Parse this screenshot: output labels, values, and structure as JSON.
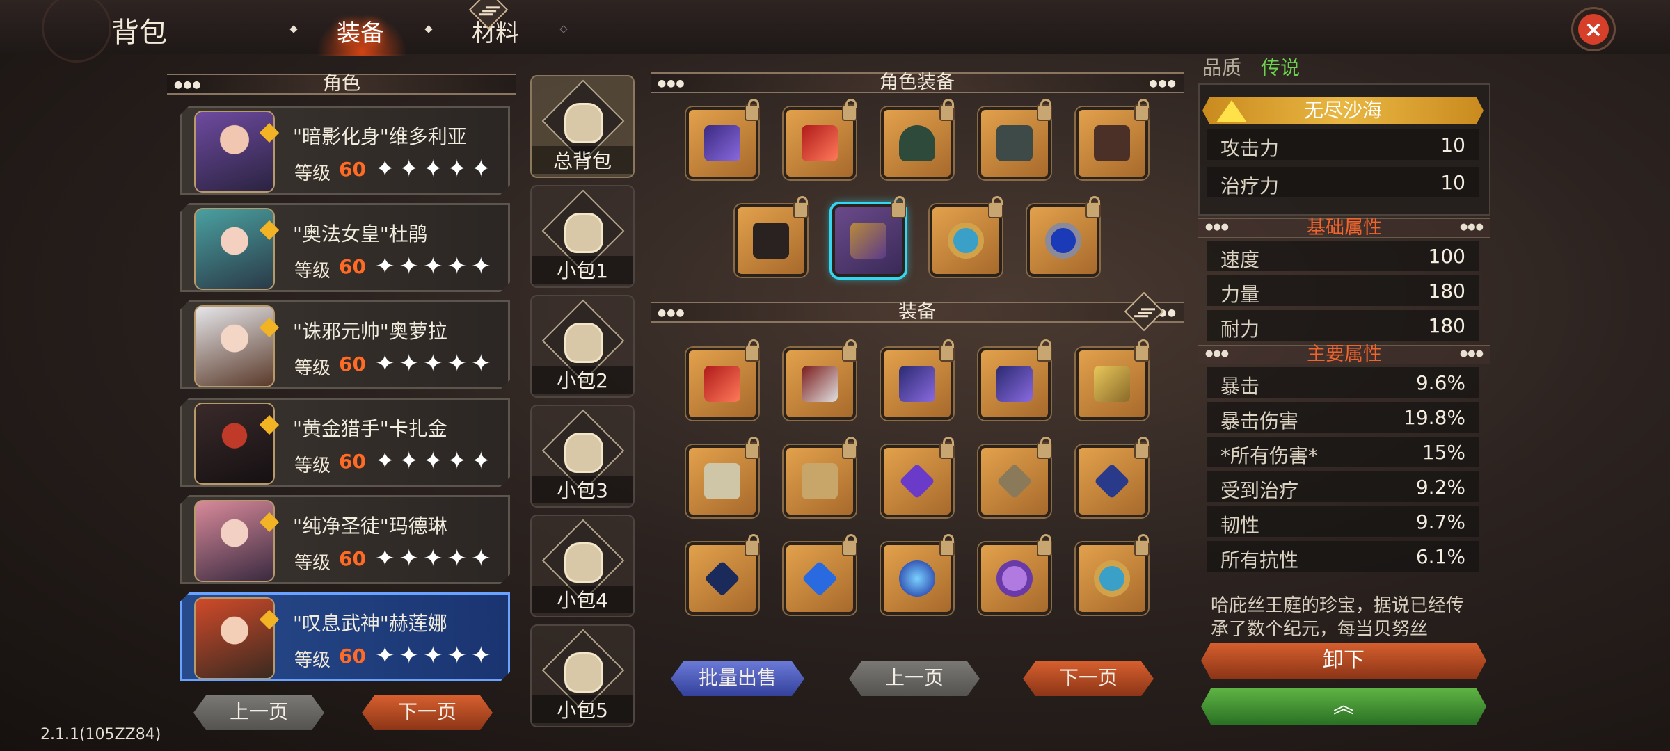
{
  "header": {
    "title": "背包",
    "tabs": [
      {
        "label": "装备",
        "active": true
      },
      {
        "label": "材料",
        "active": false
      }
    ]
  },
  "roles": {
    "heading": "角色",
    "items": [
      {
        "name": "\"暗影化身\"维多利亚",
        "level_label": "等级",
        "level": "60",
        "stars": "✦✦✦✦✦",
        "active": false
      },
      {
        "name": "\"奥法女皇\"杜鹃",
        "level_label": "等级",
        "level": "60",
        "stars": "✦✦✦✦✦",
        "active": false
      },
      {
        "name": "\"诛邪元帅\"奥萝拉",
        "level_label": "等级",
        "level": "60",
        "stars": "✦✦✦✦✦",
        "active": false
      },
      {
        "name": "\"黄金猎手\"卡扎金",
        "level_label": "等级",
        "level": "60",
        "stars": "✦✦✦✦✦",
        "active": false
      },
      {
        "name": "\"纯净圣徒\"玛德琳",
        "level_label": "等级",
        "level": "60",
        "stars": "✦✦✦✦✦",
        "active": false
      },
      {
        "name": "\"叹息武神\"赫莲娜",
        "level_label": "等级",
        "level": "60",
        "stars": "✦✦✦✦✦",
        "active": true
      }
    ],
    "prev_label": "上一页",
    "next_label": "下一页"
  },
  "bags": [
    "总背包",
    "小包1",
    "小包2",
    "小包3",
    "小包4",
    "小包5"
  ],
  "role_equipment": {
    "heading": "角色装备",
    "items": [
      "dark-sword-icon",
      "red-blade-icon",
      "hood-icon",
      "armor-icon",
      "gauntlets-icon",
      "boots-icon",
      "amulet-icon",
      "ring-icon",
      "sapphire-ring-icon"
    ]
  },
  "equipment": {
    "heading": "装备",
    "items": [
      "red-sword-icon",
      "greatblade-icon",
      "dark-sword-icon",
      "dark-sword-icon",
      "gold-helmet-icon",
      "shoulder-armor-icon",
      "bracers-icon",
      "purple-pendant-icon",
      "gold-pendant-icon",
      "blue-pendant-icon",
      "dark-necklace-icon",
      "sapphire-necklace-icon",
      "blue-gem-icon",
      "violet-ring-icon",
      "gold-ring-icon"
    ],
    "bulk_sell_label": "批量出售",
    "prev_label": "上一页",
    "next_label": "下一页"
  },
  "details": {
    "quality_label": "品质",
    "quality_value": "传说",
    "set_name": "无尽沙海",
    "core": [
      {
        "k": "攻击力",
        "v": "10"
      },
      {
        "k": "治疗力",
        "v": "10"
      }
    ],
    "base_heading": "基础属性",
    "base": [
      {
        "k": "速度",
        "v": "100"
      },
      {
        "k": "力量",
        "v": "180"
      },
      {
        "k": "耐力",
        "v": "180"
      }
    ],
    "main_heading": "主要属性",
    "main": [
      {
        "k": "暴击",
        "v": "9.6%"
      },
      {
        "k": "暴击伤害",
        "v": "19.8%"
      },
      {
        "k": "*所有伤害*",
        "v": "15%"
      },
      {
        "k": "受到治疗",
        "v": "9.2%"
      },
      {
        "k": "韧性",
        "v": "9.7%"
      },
      {
        "k": "所有抗性",
        "v": "6.1%"
      }
    ],
    "description": "哈庇丝王庭的珍宝，据说已经传承了数个纪元，每当贝努丝",
    "unequip_label": "卸下",
    "upgrade_label": "︽"
  },
  "version": "2.1.1(105ZZ84)",
  "colors": {
    "accent": "#ff6a25",
    "legend": "#e9b743",
    "sub_heading": "#f0642d",
    "quality": "#6cd250"
  }
}
